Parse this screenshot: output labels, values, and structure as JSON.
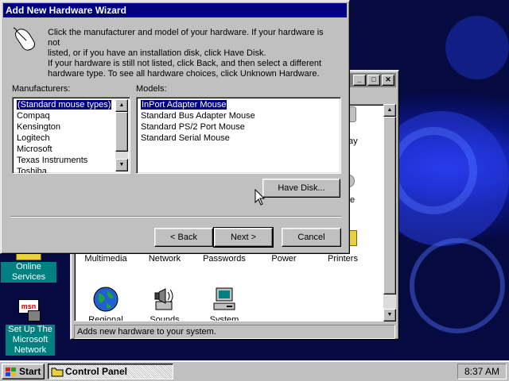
{
  "wizard": {
    "title": "Add New Hardware Wizard",
    "intro_line1": "Click the manufacturer and model of your hardware. If your hardware is not",
    "intro_line2": "listed, or if you have an installation disk, click Have Disk.",
    "intro_line3": "If your hardware is still not listed, click Back, and then select a different",
    "intro_line4": "hardware type. To see all hardware choices, click Unknown Hardware.",
    "manufacturers_label": "Manufacturers:",
    "manufacturers": [
      "(Standard mouse types)",
      "Compaq",
      "Kensington",
      "Logitech",
      "Microsoft",
      "Texas Instruments",
      "Toshiba"
    ],
    "selected_manufacturer": "(Standard mouse types)",
    "models_label": "Models:",
    "models": [
      "InPort Adapter Mouse",
      "Standard Bus Adapter Mouse",
      "Standard PS/2 Port Mouse",
      "Standard Serial Mouse"
    ],
    "selected_model": "InPort Adapter Mouse",
    "have_disk_label": "Have Disk...",
    "back_label": "< Back",
    "next_label": "Next >",
    "cancel_label": "Cancel"
  },
  "control_panel": {
    "items_row1": [
      "Multimedia",
      "Network",
      "Passwords",
      "Power",
      "Printers"
    ],
    "items_row2": [
      "Regional",
      "Sounds",
      "System"
    ],
    "partial_label_1": "ay",
    "partial_label_2": "e",
    "status_text": "Adds new hardware to your system."
  },
  "desktop": {
    "online_services": "Online Services",
    "msn_line1": "Set Up The",
    "msn_line2": "Microsoft",
    "msn_line3": "Network"
  },
  "taskbar": {
    "start_label": "Start",
    "task_label": "Control Panel",
    "clock": "8:37 AM"
  },
  "colors": {
    "title_active": "#000080",
    "title_inactive": "#808080",
    "face": "#c0c0c0",
    "desktop_label_bg": "#008080"
  }
}
